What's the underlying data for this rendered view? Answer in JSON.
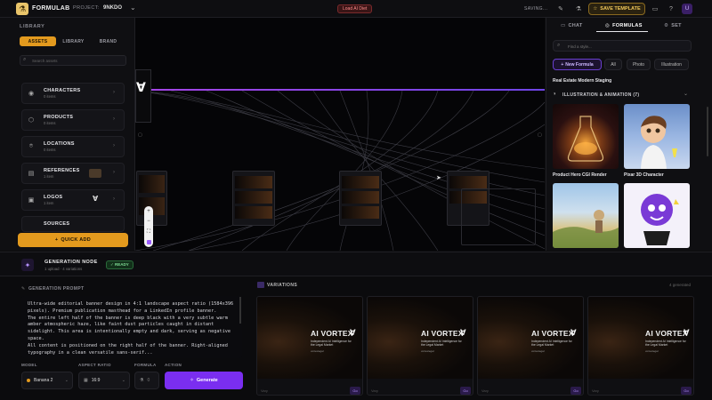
{
  "app": {
    "name": "FORMULAB",
    "project_label": "PROJECT:",
    "project_name": "9NKDO",
    "load_badge": "Load AI Diet",
    "saving_text": "SAVING...",
    "save_template_label": "SAVE TEMPLATE",
    "avatar_initial": "U"
  },
  "library": {
    "title": "LIBRARY",
    "tabs": [
      "ASSETS",
      "LIBRARY",
      "BRAND"
    ],
    "search_placeholder": "Search assets",
    "items": [
      {
        "title": "CHARACTERS",
        "count": "0 items",
        "icon": "user-icon"
      },
      {
        "title": "PRODUCTS",
        "count": "0 items",
        "icon": "box-icon"
      },
      {
        "title": "LOCATIONS",
        "count": "0 items",
        "icon": "pin-icon"
      },
      {
        "title": "REFERENCES",
        "count": "1 item",
        "icon": "file-icon"
      },
      {
        "title": "LOGOS",
        "count": "1 item",
        "icon": "image-icon"
      },
      {
        "title": "SOURCES",
        "count": "",
        "icon": "globe-icon"
      }
    ],
    "quick_add_label": "QUICK ADD"
  },
  "right_panel": {
    "tabs": [
      "CHAT",
      "FORMULAS",
      "SET"
    ],
    "search_placeholder": "Find a style...",
    "new_formula_label": "New Formula",
    "filters": [
      "All",
      "Photo",
      "Illustration"
    ],
    "featured_item": "Real Estate Modern Staging",
    "category_header": "ILLUSTRATION & ANIMATION (7)",
    "styles": [
      {
        "name": "Product Hero CGI Render"
      },
      {
        "name": "Pixar 3D Character"
      }
    ]
  },
  "generation_node": {
    "title": "GENERATION NODE",
    "subtitle": "1 upload · 4 variations",
    "status": "✓ READY"
  },
  "prompt": {
    "label": "GENERATION PROMPT",
    "text": "Ultra-wide editorial banner design in 4:1 landscape aspect ratio (1584x396 pixels). Premium publication masthead for a LinkedIn profile banner.\nThe entire left half of the banner is deep black with a very subtle warm amber atmospheric haze, like faint dust particles caught in distant sidelight. This area is intentionally empty and dark, serving as negative space.\nAll content is positioned on the right half of the banner. Right-aligned typography in a clean versatile sans-serif..."
  },
  "controls": {
    "model_label": "MODEL",
    "model_value": "Banana 2",
    "aspect_label": "ASPECT RATIO",
    "aspect_value": "16:9",
    "formula_label": "FORMULA",
    "formula_value": "0",
    "action_label": "ACTION",
    "generate_label": "Generate"
  },
  "variations": {
    "label": "VARIATIONS",
    "count_text": "4 generated",
    "card_title": "AI VORTEX",
    "card_subtitle": "Independent AI Intelligence for the Legal Market",
    "card_tag": "vortexlegal",
    "footer_left": "Vary",
    "footer_btn": "Go"
  },
  "colors": {
    "accent_orange": "#e39a1e",
    "accent_purple": "#7a2ef0",
    "ready_green": "#7fdc95",
    "gold": "#f2c95a"
  }
}
